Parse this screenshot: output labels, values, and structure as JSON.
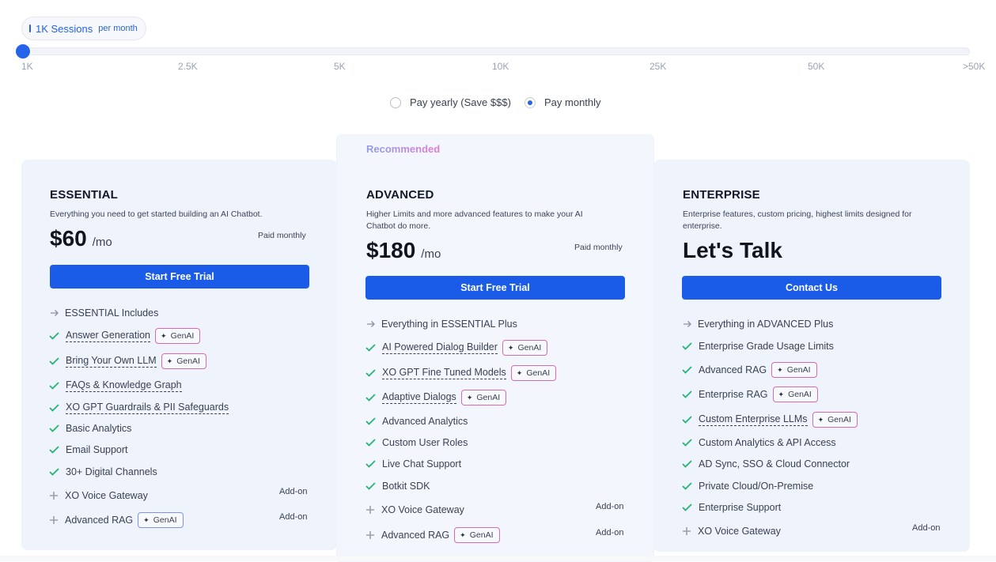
{
  "sessions": {
    "count_label": "1K Sessions",
    "unit_label": "per month",
    "ticks": [
      "1K",
      "2.5K",
      "5K",
      "10K",
      "25K",
      "50K",
      ">50K"
    ],
    "selected_index": 0
  },
  "billing": {
    "yearly_label": "Pay yearly (Save $$$)",
    "monthly_label": "Pay monthly",
    "selected": "monthly"
  },
  "colors": {
    "accent": "#1a5ce8",
    "check": "#22b573",
    "card_bg": "#eef3fc"
  },
  "recommended_label": "Recommended",
  "plans": [
    {
      "name": "ESSENTIAL",
      "description": "Everything you need to get started building an AI Chatbot.",
      "price": "$60",
      "period": "/mo",
      "billing_note": "Paid monthly",
      "cta": "Start Free Trial",
      "includes_label": "ESSENTIAL Includes",
      "features": [
        "Answer Generation",
        "Bring Your Own LLM",
        "FAQs & Knowledge Graph",
        "XO GPT Guardrails & PII Safeguards",
        "Basic Analytics",
        "Email Support",
        "30+ Digital Channels"
      ],
      "addons": [
        "XO Voice Gateway",
        "Advanced RAG"
      ],
      "addon_label": "Add-on",
      "genai_label": "GenAI"
    },
    {
      "name": "ADVANCED",
      "description": "Higher Limits and more advanced features to make your AI Chatbot do more.",
      "price": "$180",
      "period": "/mo",
      "billing_note": "Paid monthly",
      "cta": "Start Free Trial",
      "includes_label": "Everything in ESSENTIAL Plus",
      "features": [
        "AI Powered Dialog Builder",
        "XO GPT Fine Tuned Models",
        "Adaptive Dialogs",
        "Advanced Analytics",
        "Custom User Roles",
        "Live Chat Support",
        "Botkit SDK"
      ],
      "addons": [
        "XO Voice Gateway",
        "Advanced RAG"
      ],
      "addon_label": "Add-on",
      "genai_label": "GenAI"
    },
    {
      "name": "ENTERPRISE",
      "description": "Enterprise features, custom pricing, highest limits designed for enterprise.",
      "price": "Let's Talk",
      "cta": "Contact Us",
      "includes_label": "Everything in ADVANCED Plus",
      "features": [
        "Enterprise Grade Usage Limits",
        "Advanced RAG",
        "Enterprise RAG",
        "Custom Enterprise LLMs",
        "Custom Analytics & API Access",
        "AD Sync, SSO & Cloud Connector",
        "Private Cloud/On-Premise",
        "Enterprise Support"
      ],
      "addons": [
        "XO Voice Gateway"
      ],
      "addon_label": "Add-on",
      "genai_label": "GenAI"
    }
  ]
}
